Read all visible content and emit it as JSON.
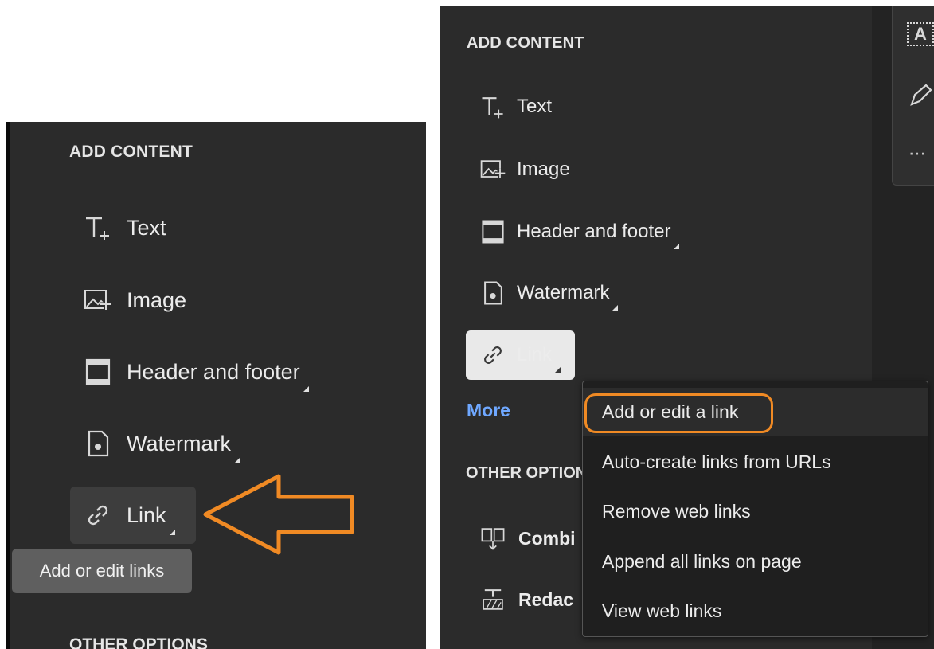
{
  "left": {
    "section_title": "ADD CONTENT",
    "tools": [
      {
        "label": "Text",
        "icon": "text-add-icon"
      },
      {
        "label": "Image",
        "icon": "image-add-icon"
      },
      {
        "label": "Header and footer",
        "icon": "header-footer-icon"
      },
      {
        "label": "Watermark",
        "icon": "watermark-icon"
      },
      {
        "label": "Link",
        "icon": "link-icon"
      }
    ],
    "tooltip": "Add or edit links",
    "other_options": "OTHER OPTIONS"
  },
  "right": {
    "section_title": "ADD CONTENT",
    "tools": [
      {
        "label": "Text",
        "icon": "text-add-icon"
      },
      {
        "label": "Image",
        "icon": "image-add-icon"
      },
      {
        "label": "Header and footer",
        "icon": "header-footer-icon"
      },
      {
        "label": "Watermark",
        "icon": "watermark-icon"
      },
      {
        "label": "Link",
        "icon": "link-icon"
      }
    ],
    "more": "More",
    "other_options": "OTHER OPTION",
    "other_tools": [
      {
        "label": "Combi",
        "icon": "combine-icon"
      },
      {
        "label": "Redac",
        "icon": "redact-icon"
      }
    ],
    "menu": [
      {
        "label": "Add or edit a link",
        "highlighted": true
      },
      {
        "label": "Auto-create links from URLs"
      },
      {
        "label": "Remove web links"
      },
      {
        "label": "Append all links on page"
      },
      {
        "label": "View web links"
      }
    ],
    "strip": {
      "icons": [
        "text-box-icon",
        "edit-pen-icon",
        "more-dots-icon"
      ],
      "text_box_glyph": "A",
      "dots": "⋯"
    }
  },
  "colors": {
    "panel_bg": "#2b2b2b",
    "tooltip_bg": "#5f5f5f",
    "selected_button_bg": "#e9e9e9",
    "more_link": "#6fa8ff",
    "annotation_orange": "#f08a24"
  }
}
